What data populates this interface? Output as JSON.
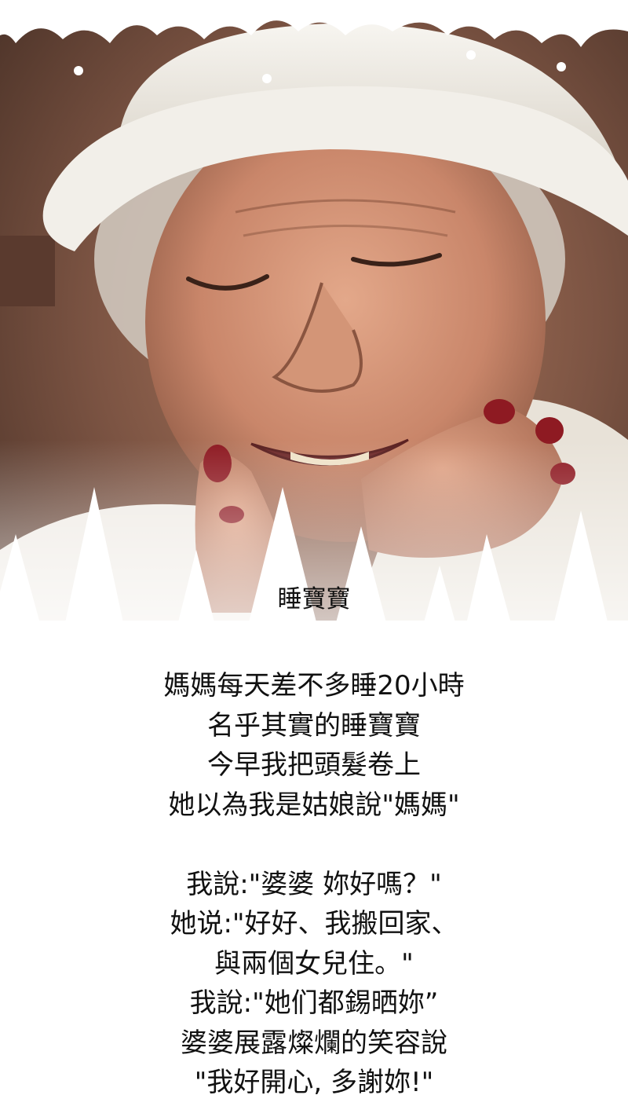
{
  "title": "睡寶寶",
  "stanza1": [
    "媽媽每天差不多睡20小時",
    "名乎其實的睡寶寶",
    "今早我把頭髮卷上",
    "她以為我是姑娘說\"媽媽\""
  ],
  "stanza2": [
    "我說:\"婆婆 妳好嗎？\"",
    "她说:\"好好、我搬回家、",
    "與兩個女兒住。\"",
    "我說:\"她们都錫晒妳”",
    "婆婆展露燦爛的笑容說",
    "\"我好開心, 多謝妳!\""
  ],
  "colors": {
    "wall": "#6a4738",
    "hat": "#ebe7df",
    "skin": "#c9866a",
    "nail_polish": "#8e1a22",
    "text": "#111111",
    "snow": "#ffffff"
  }
}
